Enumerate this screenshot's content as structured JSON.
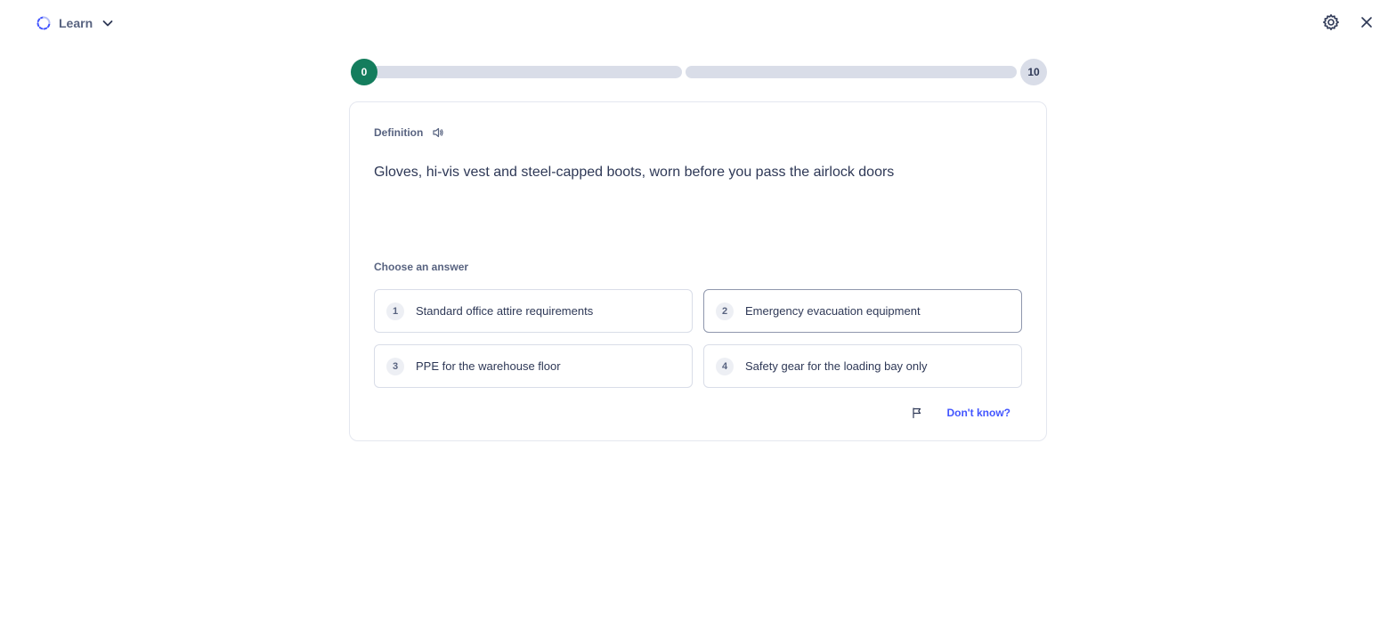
{
  "header": {
    "mode_label": "Learn",
    "mode_icon": "learn-loop-icon",
    "settings_icon": "gear-icon",
    "close_icon": "close-icon"
  },
  "progress": {
    "start_count": "0",
    "end_count": "10",
    "segments_filled": [
      0,
      0
    ]
  },
  "question": {
    "prompt_label": "Definition",
    "speaker_icon": "speaker-icon",
    "text": "Gloves, hi-vis vest and steel-capped boots, worn before you pass the airlock doors",
    "choose_label": "Choose an answer"
  },
  "answers": [
    {
      "number": "1",
      "text": "Standard office attire requirements"
    },
    {
      "number": "2",
      "text": "Emergency evacuation equipment"
    },
    {
      "number": "3",
      "text": "PPE for the warehouse floor"
    },
    {
      "number": "4",
      "text": "Safety gear for the loading bay only"
    }
  ],
  "footer": {
    "flag_icon": "flag-icon",
    "dont_know_label": "Don't know?"
  },
  "colors": {
    "accent": "#4255ff",
    "progress_start": "#147d5d",
    "track": "#d9dde8",
    "text": "#2e3856"
  }
}
